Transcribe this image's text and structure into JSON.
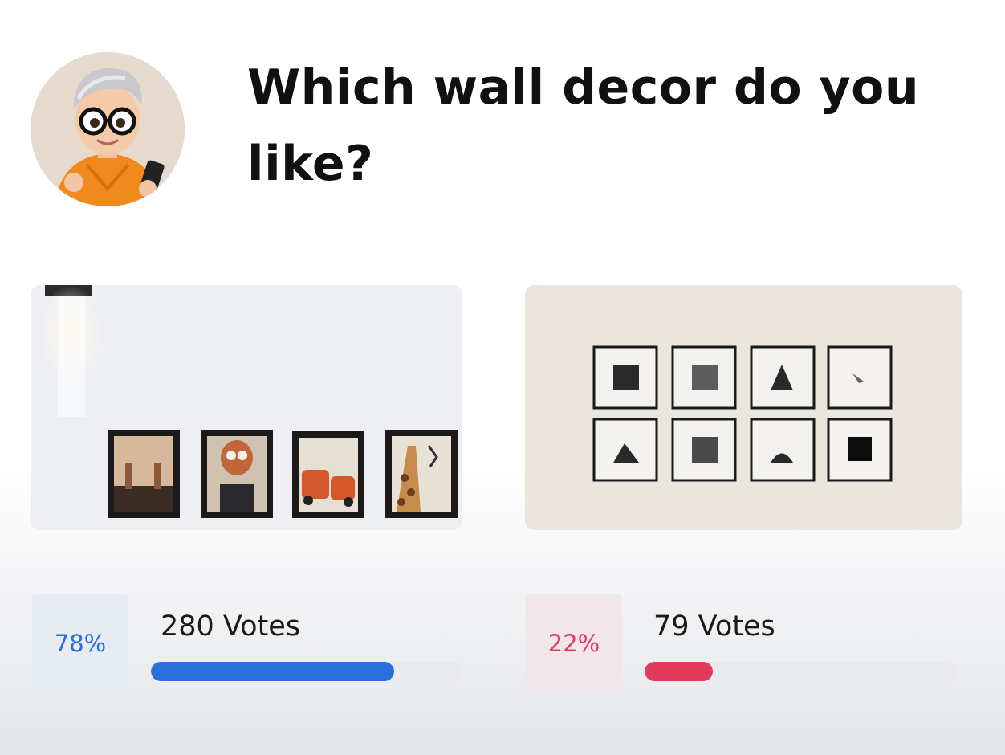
{
  "question": {
    "title": "Which wall decor do you like?"
  },
  "options": [
    {
      "image_icon": "framed-animal-art-photo",
      "percent_label": "78%",
      "percent_value": 0.78,
      "votes_label": "280 Votes",
      "accent_color": "#2a6fdb"
    },
    {
      "image_icon": "black-white-photo-grid",
      "percent_label": "22%",
      "percent_value": 0.22,
      "votes_label": "79 Votes",
      "accent_color": "#e23a5c"
    }
  ],
  "avatar": {
    "icon": "cartoon-avatar"
  }
}
